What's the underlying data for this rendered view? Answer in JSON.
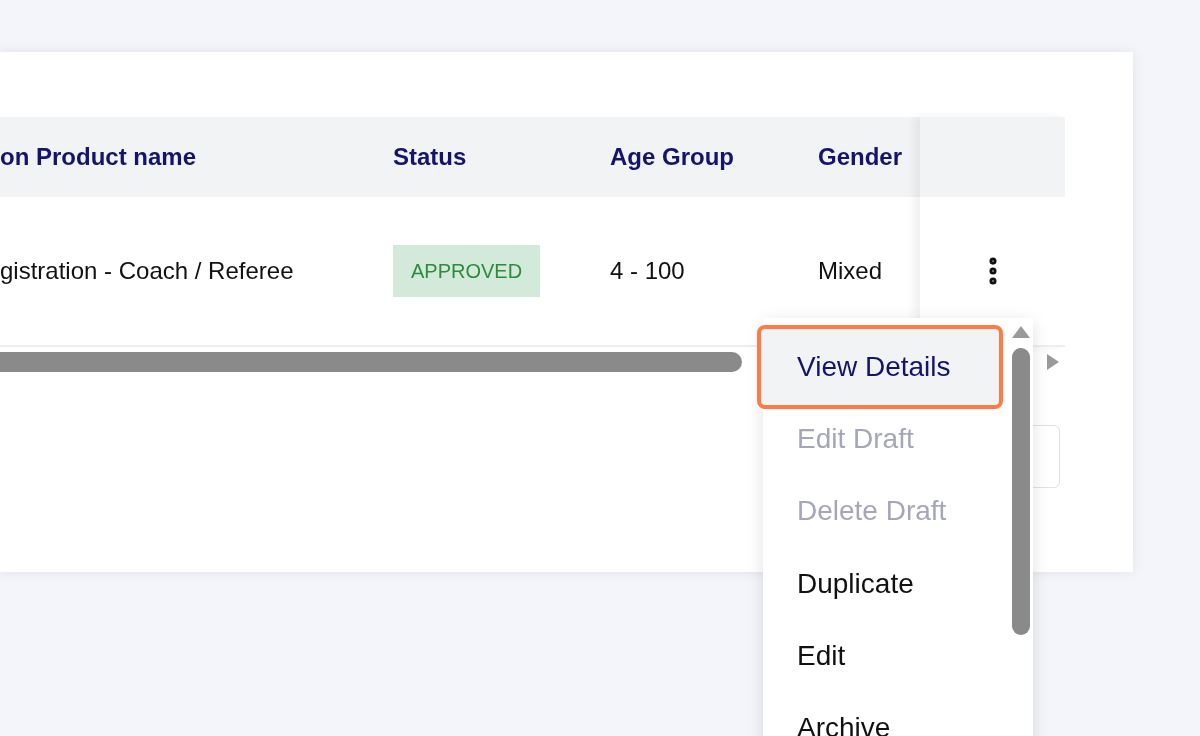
{
  "table": {
    "columns": [
      "on Product name",
      "Status",
      "Age Group",
      "Gender"
    ],
    "rows": [
      {
        "cells": [
          {
            "kind": "text",
            "text": "gistration - Coach / Referee"
          },
          {
            "kind": "badge",
            "text": "APPROVED",
            "color": "#d3eadb"
          },
          {
            "kind": "text",
            "text": "4 - 100"
          },
          {
            "kind": "text",
            "text": "Mixed"
          }
        ]
      }
    ]
  },
  "menu": {
    "items": [
      {
        "label": "View Details",
        "selected": true,
        "disabled": false
      },
      {
        "label": "Edit Draft",
        "selected": false,
        "disabled": true
      },
      {
        "label": "Delete Draft",
        "selected": false,
        "disabled": true
      },
      {
        "label": "Duplicate",
        "selected": false,
        "disabled": false
      },
      {
        "label": "Edit",
        "selected": false,
        "disabled": false
      },
      {
        "label": "Archive",
        "selected": false,
        "disabled": false
      }
    ]
  }
}
